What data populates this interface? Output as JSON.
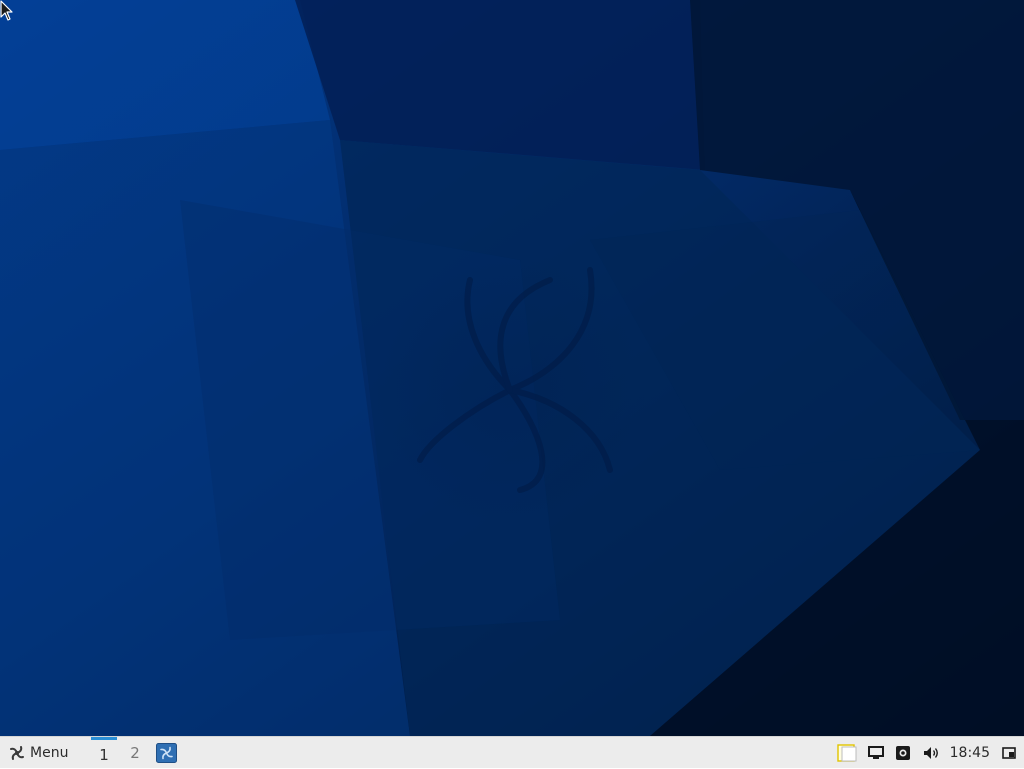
{
  "taskbar": {
    "menu_label": "Menu",
    "workspaces": [
      {
        "label": "1",
        "active": true
      },
      {
        "label": "2",
        "active": false
      }
    ],
    "launcher_icon": "app-launcher-icon",
    "tray": {
      "icons": [
        "sticky-notes-icon",
        "display-icon",
        "screenshot-icon",
        "volume-icon",
        "show-desktop-icon"
      ],
      "clock": "18:45"
    }
  },
  "colors": {
    "wallpaper_dark": "#001a3d",
    "wallpaper_light": "#034497",
    "panel_bg": "#ececec",
    "workspace_indicator": "#2a8fd6"
  }
}
